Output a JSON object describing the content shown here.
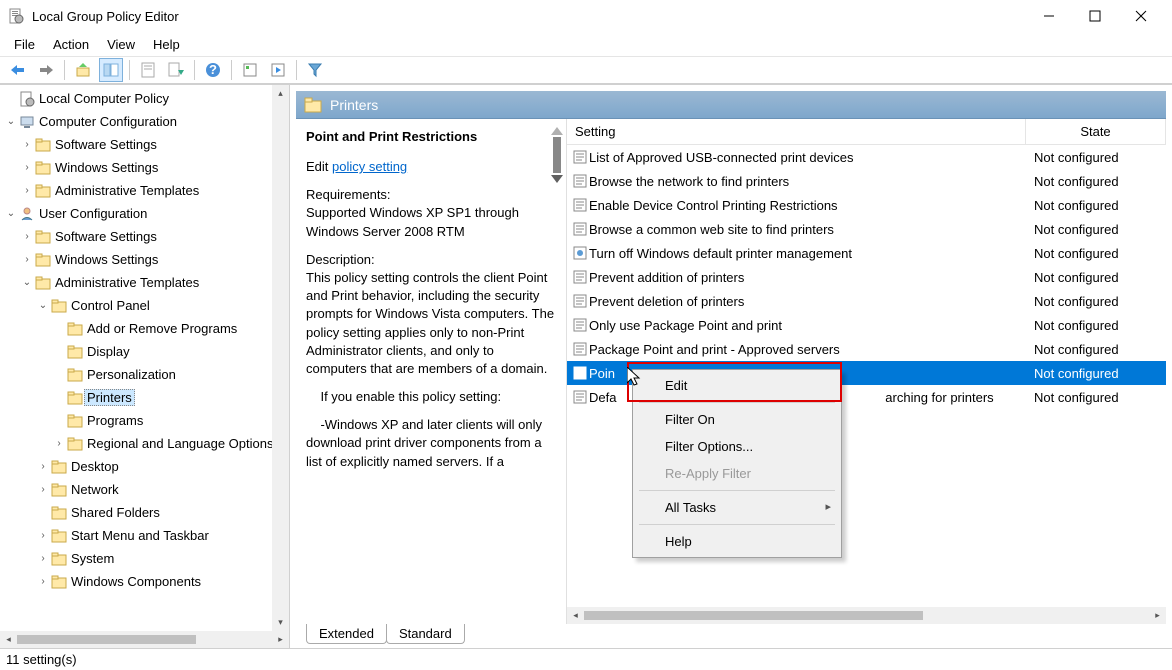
{
  "window": {
    "title": "Local Group Policy Editor"
  },
  "menubar": [
    "File",
    "Action",
    "View",
    "Help"
  ],
  "tree": {
    "root": "Local Computer Policy",
    "cc": "Computer Configuration",
    "cc_soft": "Software Settings",
    "cc_win": "Windows Settings",
    "cc_adm": "Administrative Templates",
    "uc": "User Configuration",
    "uc_soft": "Software Settings",
    "uc_win": "Windows Settings",
    "uc_adm": "Administrative Templates",
    "cp": "Control Panel",
    "cp_add": "Add or Remove Programs",
    "cp_disp": "Display",
    "cp_pers": "Personalization",
    "cp_prn": "Printers",
    "cp_prog": "Programs",
    "cp_reg": "Regional and Language Options",
    "desk": "Desktop",
    "net": "Network",
    "shf": "Shared Folders",
    "stm": "Start Menu and Taskbar",
    "sys": "System",
    "wc": "Windows Components"
  },
  "header": {
    "title": "Printers"
  },
  "desc": {
    "title": "Point and Print Restrictions",
    "edit_prefix": "Edit ",
    "edit_link": "policy setting",
    "req_label": "Requirements:",
    "req_text": "Supported Windows XP SP1 through Windows Server 2008 RTM",
    "d_label": "Description:",
    "d_text": "This policy setting controls the client Point and Print behavior, including the security prompts for Windows Vista computers. The policy setting applies only to non-Print Administrator clients, and only to computers that are members of a domain.",
    "d_text2": "    If you enable this policy setting:",
    "d_text3": "    -Windows XP and later clients will only download print driver components from a list of explicitly named servers. If a"
  },
  "columns": {
    "setting": "Setting",
    "state": "State"
  },
  "rows": [
    {
      "name": "List of Approved USB-connected print devices",
      "state": "Not configured"
    },
    {
      "name": "Browse the network to find printers",
      "state": "Not configured"
    },
    {
      "name": "Enable Device Control Printing Restrictions",
      "state": "Not configured"
    },
    {
      "name": "Browse a common web site to find printers",
      "state": "Not configured"
    },
    {
      "name": "Turn off Windows default printer management",
      "state": "Not configured",
      "special": true
    },
    {
      "name": "Prevent addition of printers",
      "state": "Not configured"
    },
    {
      "name": "Prevent deletion of printers",
      "state": "Not configured"
    },
    {
      "name": "Only use Package Point and print",
      "state": "Not configured"
    },
    {
      "name": "Package Point and print - Approved servers",
      "state": "Not configured"
    },
    {
      "name": "Point and Print Restrictions",
      "state": "Not configured",
      "selected": true,
      "truncated": "Poin"
    },
    {
      "name": "Default Active Directory path when searching for printers",
      "state": "Not configured",
      "truncated": "Defa"
    }
  ],
  "context_menu": {
    "edit": "Edit",
    "filter_on": "Filter On",
    "filter_options": "Filter Options...",
    "reapply": "Re-Apply Filter",
    "all_tasks": "All Tasks",
    "help": "Help"
  },
  "tabs": {
    "extended": "Extended",
    "standard": "Standard"
  },
  "status": "11 setting(s)"
}
